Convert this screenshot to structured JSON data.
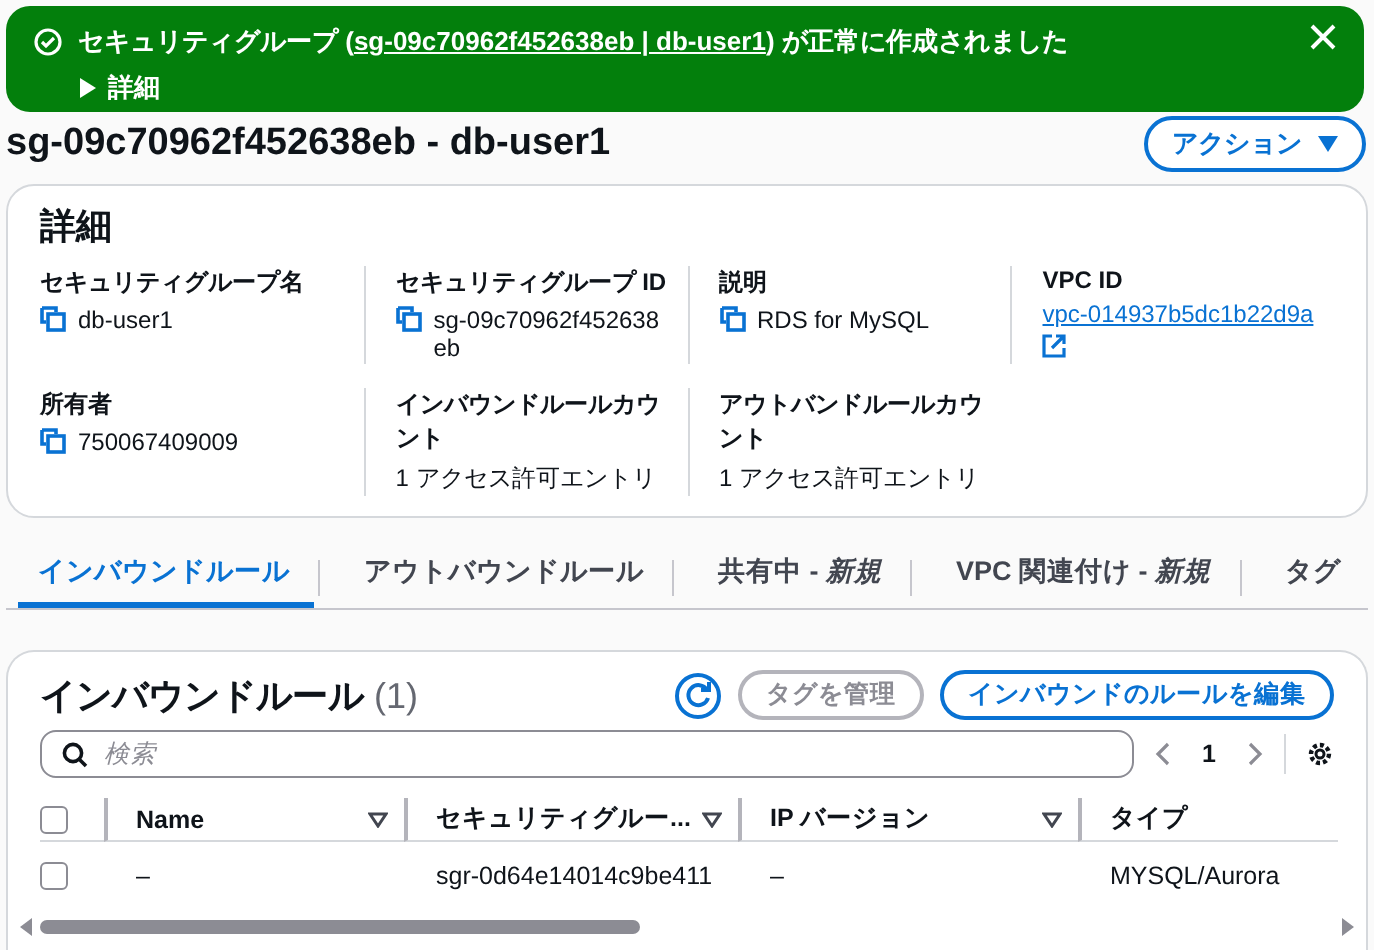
{
  "flash": {
    "text_before": "セキュリティグループ (",
    "link": "sg-09c70962f452638eb | db-user1",
    "text_after": ") が正常に作成されました",
    "details_label": "詳細",
    "expanded": false
  },
  "page_title": "sg-09c70962f452638eb - db-user1",
  "actions_button": "アクション",
  "details": {
    "title": "詳細",
    "fields": [
      {
        "label": "セキュリティグループ名",
        "value": "db-user1",
        "kind": "copy"
      },
      {
        "label": "セキュリティグループ ID",
        "value": "sg-09c70962f452638eb",
        "kind": "copy"
      },
      {
        "label": "説明",
        "value": "RDS for MySQL",
        "kind": "copy"
      },
      {
        "label": "VPC ID",
        "value": "vpc-014937b5dc1b22d9a",
        "kind": "link"
      },
      {
        "label": "所有者",
        "value": "750067409009",
        "kind": "copy"
      },
      {
        "label": "インバウンドルールカウント",
        "value": "1 アクセス許可エントリ",
        "kind": "text"
      },
      {
        "label": "アウトバンドルールカウント",
        "value": "1 アクセス許可エントリ",
        "kind": "text"
      }
    ]
  },
  "tabs": [
    {
      "label": "インバウンドルール",
      "selected": true
    },
    {
      "label": "アウトバウンドルール",
      "selected": false
    },
    {
      "label": "共有中 - *新規*",
      "selected": false
    },
    {
      "label": "VPC 関連付け - *新規*",
      "selected": false
    },
    {
      "label": "タグ",
      "selected": false
    }
  ],
  "rules_table": {
    "title": "インバウンドルール",
    "count": "(1)",
    "manage_tags_button": {
      "label": "タグを管理",
      "disabled": true
    },
    "edit_button": "インバウンドのルールを編集",
    "search": {
      "placeholder": "検索"
    },
    "page": "1",
    "select_all_checked": false,
    "columns": [
      "Name",
      "セキュリティグルー...",
      "IP バージョン",
      "タイプ"
    ],
    "rows": [
      {
        "checked": false,
        "cells": [
          "–",
          "sgr-0d64e14014c9be411",
          "–",
          "MYSQL/Aurora"
        ]
      }
    ]
  }
}
